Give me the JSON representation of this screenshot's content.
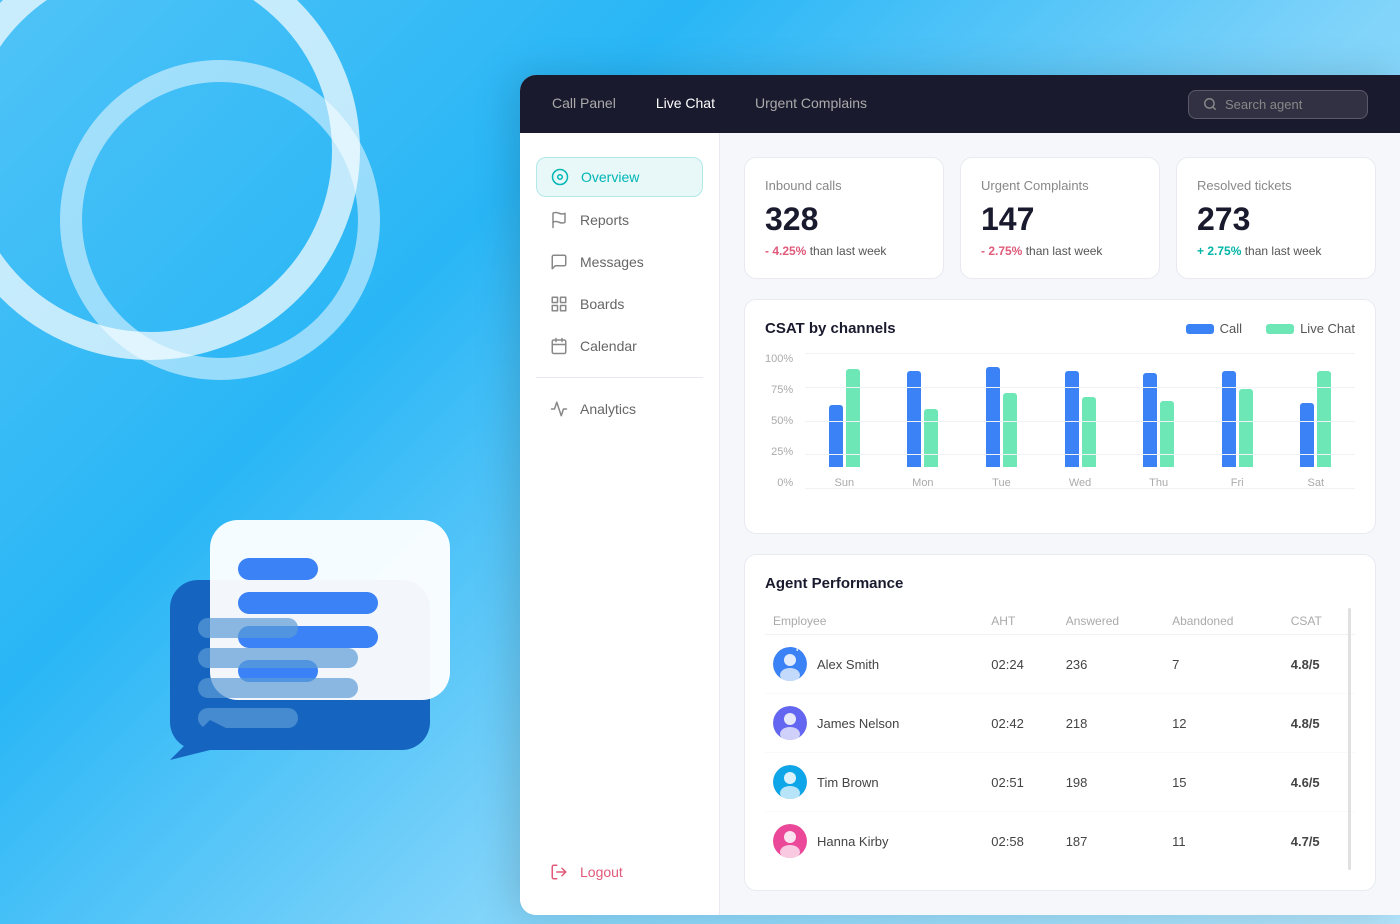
{
  "nav": {
    "items": [
      {
        "label": "Call Panel",
        "active": false
      },
      {
        "label": "Live Chat",
        "active": true
      },
      {
        "label": "Urgent Complains",
        "active": false
      }
    ],
    "search_placeholder": "Search agent"
  },
  "sidebar": {
    "items": [
      {
        "id": "overview",
        "label": "Overview",
        "active": true
      },
      {
        "id": "reports",
        "label": "Reports",
        "active": false
      },
      {
        "id": "messages",
        "label": "Messages",
        "active": false
      },
      {
        "id": "boards",
        "label": "Boards",
        "active": false
      },
      {
        "id": "calendar",
        "label": "Calendar",
        "active": false
      },
      {
        "id": "analytics",
        "label": "Analytics",
        "active": false
      }
    ],
    "logout_label": "Logout"
  },
  "stats": [
    {
      "label": "Inbound calls",
      "value": "328",
      "change": "- 4.25%",
      "change_type": "neg",
      "change_suffix": " than last week"
    },
    {
      "label": "Urgent Complaints",
      "value": "147",
      "change": "- 2.75%",
      "change_type": "neg",
      "change_suffix": " than last week"
    },
    {
      "label": "Resolved tickets",
      "value": "273",
      "change": "+ 2.75%",
      "change_type": "pos",
      "change_suffix": " than last week"
    }
  ],
  "chart": {
    "title": "CSAT by channels",
    "legend": [
      {
        "label": "Call",
        "type": "call"
      },
      {
        "label": "Live Chat",
        "type": "livechat"
      }
    ],
    "y_labels": [
      "100%",
      "75%",
      "50%",
      "25%",
      "0%"
    ],
    "bars": [
      {
        "day": "Sun",
        "call": 52,
        "livechat": 82
      },
      {
        "day": "Mon",
        "call": 80,
        "livechat": 48
      },
      {
        "day": "Tue",
        "call": 83,
        "livechat": 62
      },
      {
        "day": "Wed",
        "call": 80,
        "livechat": 58
      },
      {
        "day": "Thu",
        "call": 78,
        "livechat": 55
      },
      {
        "day": "Fri",
        "call": 80,
        "livechat": 65
      },
      {
        "day": "Sat",
        "call": 53,
        "livechat": 80
      }
    ]
  },
  "performance": {
    "title": "Agent Performance",
    "columns": [
      "Employee",
      "AHT",
      "Answered",
      "Abandoned",
      "CSAT"
    ],
    "rows": [
      {
        "name": "Alex Smith",
        "you": true,
        "aht": "02:24",
        "answered": "236",
        "abandoned": "7",
        "csat": "4.8/5"
      },
      {
        "name": "James Nelson",
        "you": false,
        "aht": "02:42",
        "answered": "218",
        "abandoned": "12",
        "csat": "4.8/5"
      },
      {
        "name": "Tim Brown",
        "you": false,
        "aht": "02:51",
        "answered": "198",
        "abandoned": "15",
        "csat": "4.6/5"
      },
      {
        "name": "Hanna Kirby",
        "you": false,
        "aht": "02:58",
        "answered": "187",
        "abandoned": "11",
        "csat": "4.7/5"
      }
    ]
  }
}
